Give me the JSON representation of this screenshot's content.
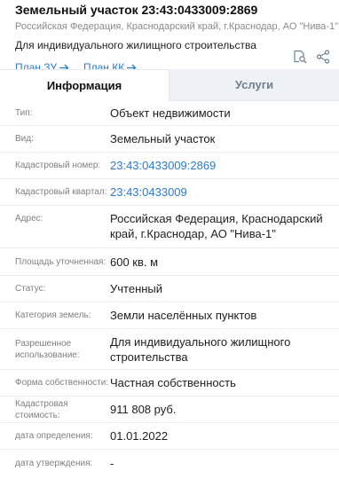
{
  "header": {
    "title": "Земельный участок 23:43:0433009:2869",
    "address": "Российская Федерация, Краснодарский край, г.Краснодар, АО \"Нива-1\"",
    "purpose": "Для индивидуального жилищного строительства",
    "plan_zu": "План ЗУ",
    "plan_kk": "План КК"
  },
  "tools": {
    "icons": [
      "search-in-document-icon",
      "share-icon"
    ]
  },
  "tabs": [
    {
      "label": "Информация",
      "active": true
    },
    {
      "label": "Услуги",
      "active": false
    }
  ],
  "rows": [
    {
      "label": "Тип:",
      "value": "Объект недвижимости"
    },
    {
      "label": "Вид:",
      "value": "Земельный участок"
    },
    {
      "label": "Кадастровый номер:",
      "value": "23:43:0433009:2869",
      "link": true
    },
    {
      "label": "Кадастровый квартал:",
      "value": "23:43:0433009",
      "link": true
    },
    {
      "label": "Адрес:",
      "value": "Российская Федерация, Краснодарский край, г.Краснодар, АО \"Нива-1\""
    },
    {
      "label": "Площадь уточненная:",
      "value": "600 кв. м"
    },
    {
      "label": "Статус:",
      "value": "Учтенный"
    },
    {
      "label": "Категория земель:",
      "value": "Земли населённых пунктов"
    },
    {
      "label": "Разрешенное использование:",
      "value": "Для индивидуального жилищного строительства"
    },
    {
      "label": "Форма собственности:",
      "value": "Частная собственность"
    },
    {
      "label": "Кадастровая стоимость:",
      "value": "911 808 руб."
    },
    {
      "label": "дата определения:",
      "value": "01.01.2022"
    },
    {
      "label": "дата утверждения:",
      "value": "-"
    }
  ],
  "colors": {
    "link": "#2b7bd1",
    "tab_inactive_bg": "#eef2f6",
    "label": "#7f7f7f"
  }
}
